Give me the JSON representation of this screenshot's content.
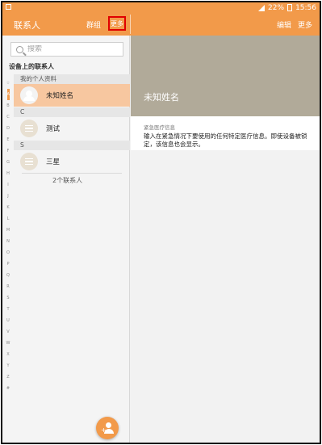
{
  "status_bar": {
    "battery": "22%",
    "time": "15:56"
  },
  "app_bar": {
    "title": "联系人",
    "groups": "群组",
    "more_left": "更多",
    "edit": "编辑",
    "more_right": "更多"
  },
  "left_pane": {
    "search_placeholder": "搜索",
    "device_contacts": "设备上的联系人",
    "alphabet": [
      "☆",
      "A",
      "B",
      "C",
      "D",
      "E",
      "F",
      "G",
      "H",
      "I",
      "J",
      "K",
      "L",
      "M",
      "N",
      "O",
      "P",
      "Q",
      "R",
      "S",
      "T",
      "U",
      "V",
      "W",
      "X",
      "Y",
      "Z",
      "#"
    ],
    "sections": [
      {
        "header": "我的个人资料",
        "contacts": [
          {
            "name": "未知姓名",
            "avatar": "profile-avatar-icon",
            "selected": true
          }
        ]
      },
      {
        "header": "C",
        "contacts": [
          {
            "name": "测试",
            "avatar": "contact-avatar-icon",
            "selected": false
          }
        ]
      },
      {
        "header": "S",
        "contacts": [
          {
            "name": "三星",
            "avatar": "contact-avatar-icon",
            "selected": false
          }
        ]
      }
    ],
    "contact_count": "2个联系人"
  },
  "right_pane": {
    "hero_name": "未知姓名",
    "medical_label": "紧急医疗信息",
    "medical_text": "输入在紧急情况下要使用的任何特定医疗信息。即使设备被锁定，该信息也会显示。"
  },
  "colors": {
    "accent": "#f29a4a",
    "selected_row": "#f7c7a0",
    "hero": "#b1aa99",
    "highlight_border": "#e00000"
  }
}
